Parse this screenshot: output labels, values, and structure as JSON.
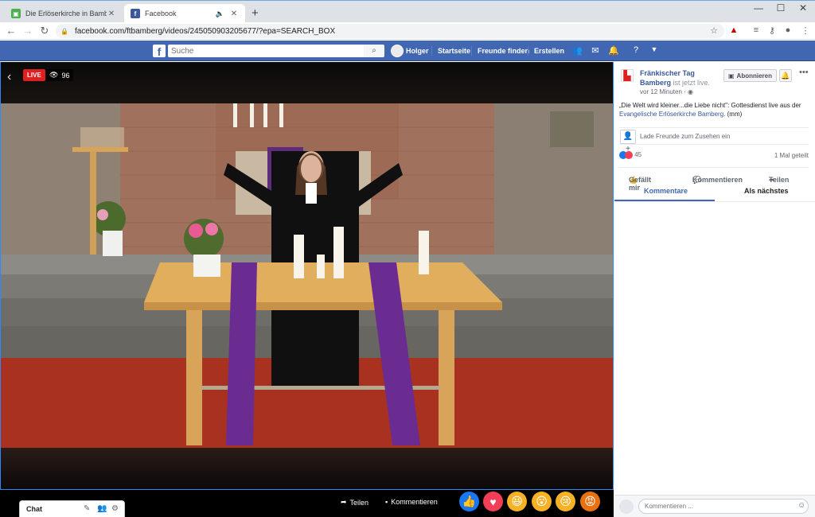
{
  "browser": {
    "tabs": [
      {
        "title": "Die Erlöserkirche in Bamberg ist l",
        "favicon": "green-square-icon"
      },
      {
        "title": "Facebook",
        "favicon": "facebook-icon"
      }
    ],
    "url": "facebook.com/ftbamberg/videos/245050903205677/?epa=SEARCH_BOX"
  },
  "fb": {
    "search_placeholder": "Suche",
    "user": "Holger",
    "nav": [
      "Startseite",
      "Freunde finden",
      "Erstellen"
    ],
    "colors": {
      "brand": "#4267b2",
      "live": "#e02020"
    }
  },
  "video": {
    "live_label": "LIVE",
    "viewers": "96",
    "share_label": "Teilen",
    "comment_label": "Kommentieren"
  },
  "chat": {
    "label": "Chat"
  },
  "sidebar": {
    "page_name": "Fränkischer Tag Bamberg",
    "status": "ist jetzt live.",
    "time": "vor 12 Minuten ·",
    "subscribe": "Abonnieren",
    "description": "„Die Welt wird kleiner...die Liebe nicht\": Gottesdienst live aus der",
    "description_link": "Evangelische Erlöserkirche Bamberg.",
    "description_suffix": "(mm)",
    "invite": "Lade Freunde zum Zusehen ein",
    "reactions_count": "45",
    "shares": "1 Mal geteilt",
    "actions": [
      "Gefällt mir",
      "Kommentieren",
      "Teilen"
    ],
    "tabs": [
      "Kommentare",
      "Als nächstes"
    ],
    "comment_placeholder": "Kommentieren ..."
  }
}
